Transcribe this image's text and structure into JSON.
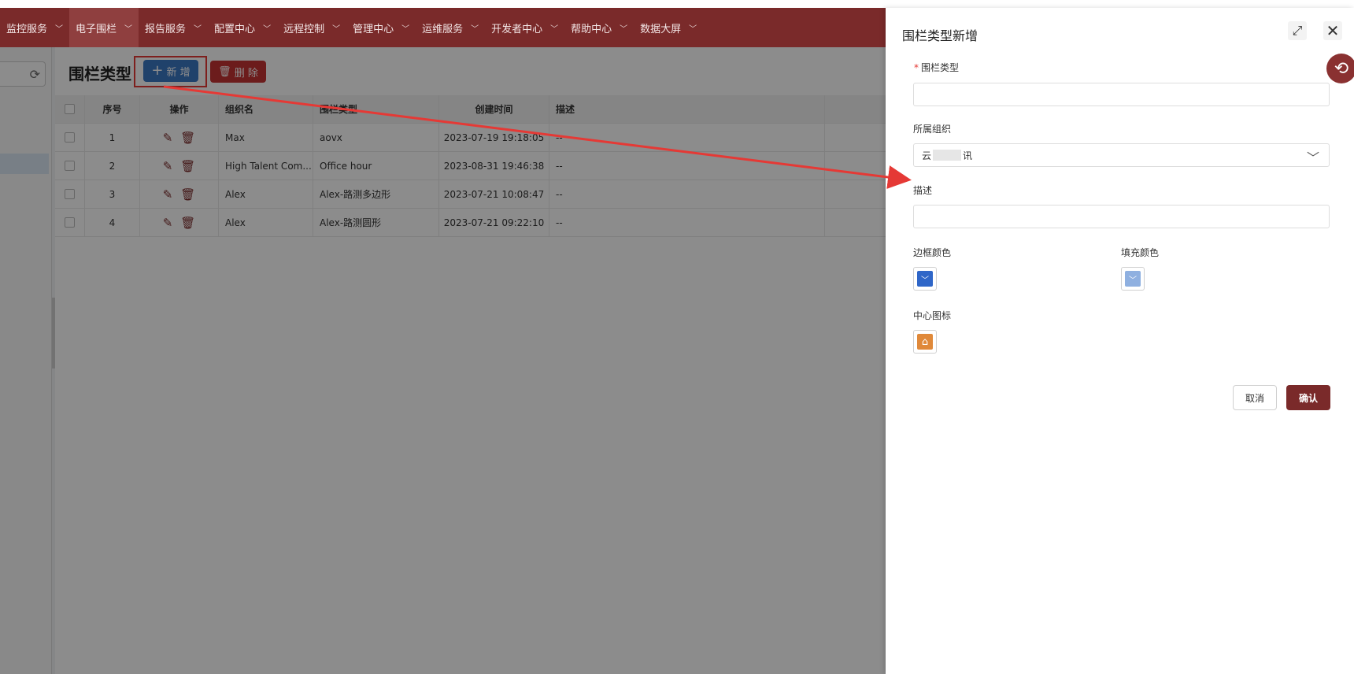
{
  "nav": {
    "items": [
      {
        "label": "监控服务",
        "active": false
      },
      {
        "label": "电子围栏",
        "active": true
      },
      {
        "label": "报告服务",
        "active": false
      },
      {
        "label": "配置中心",
        "active": false
      },
      {
        "label": "远程控制",
        "active": false
      },
      {
        "label": "管理中心",
        "active": false
      },
      {
        "label": "运维服务",
        "active": false
      },
      {
        "label": "开发者中心",
        "active": false
      },
      {
        "label": "帮助中心",
        "active": false
      },
      {
        "label": "数据大屏",
        "active": false
      }
    ]
  },
  "main": {
    "title": "围栏类型",
    "add_label": "新 增",
    "delete_label": "删 除",
    "columns": [
      "序号",
      "操作",
      "组织名",
      "围栏类型",
      "创建时间",
      "描述"
    ],
    "rows": [
      {
        "no": "1",
        "org": "Max",
        "type": "aovx",
        "time": "2023-07-19 19:18:05",
        "desc": "--"
      },
      {
        "no": "2",
        "org": "High Talent Com...",
        "type": "Office hour",
        "time": "2023-08-31 19:46:38",
        "desc": "--"
      },
      {
        "no": "3",
        "org": "Alex",
        "type": "Alex-路测多边形",
        "time": "2023-07-21 10:08:47",
        "desc": "--"
      },
      {
        "no": "4",
        "org": "Alex",
        "type": "Alex-路测圆形",
        "time": "2023-07-21 09:22:10",
        "desc": "--"
      }
    ]
  },
  "drawer": {
    "title": "围栏类型新增",
    "fields": {
      "fence_type_label": "围栏类型",
      "fence_type_required_mark": "*",
      "org_label": "所属组织",
      "org_value_start": "云",
      "org_value_end": "讯",
      "desc_label": "描述",
      "border_color_label": "边框颜色",
      "fill_color_label": "填充颜色",
      "center_icon_label": "中心图标"
    },
    "cancel_label": "取消",
    "confirm_label": "确认"
  },
  "colors": {
    "nav_bg": "#7a2a2a",
    "primary_blue": "#3b78c3",
    "danger_red": "#c53434",
    "border_color_swatch": "#2f66c8",
    "fill_color_swatch": "#8fb0e0",
    "center_icon_swatch": "#e0893a",
    "annotation_red": "#e53935"
  },
  "icons": {
    "refresh": "refresh-icon",
    "expand": "expand-icon",
    "close": "close-icon",
    "history": "history-icon",
    "edit": "edit-icon",
    "trash": "trash-icon",
    "home": "home-icon",
    "chevron": "chevron-down-icon"
  }
}
